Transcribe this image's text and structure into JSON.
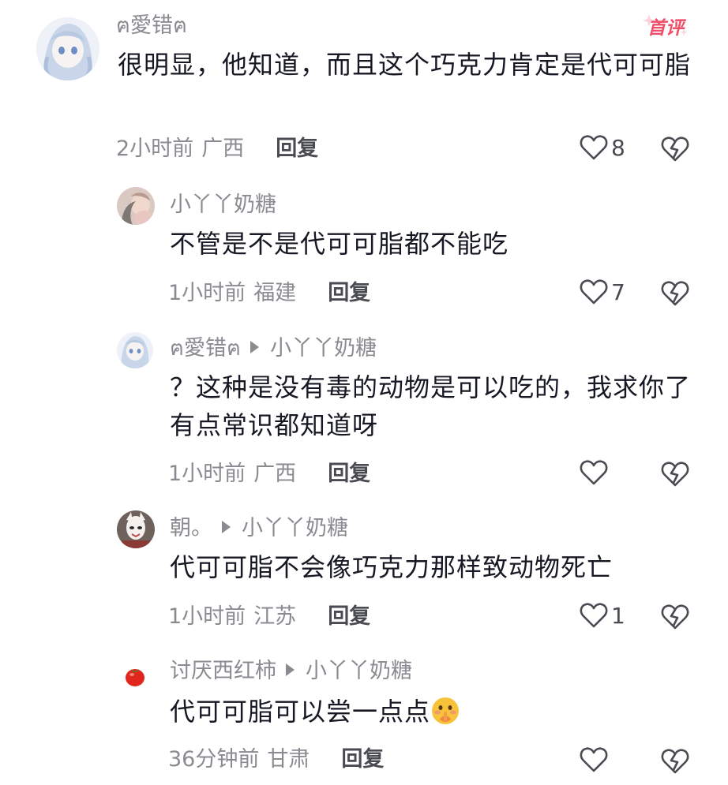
{
  "comments": [
    {
      "username": "ฅ愛错ฅ",
      "badge": "首评",
      "text": "很明显，他知道，而且这个巧克力肯定是代可可脂",
      "time": "2小时前",
      "location": "广西",
      "reply_label": "回复",
      "likes": "8",
      "avatar_icon": "anime-girl-avatar"
    },
    {
      "username": "小丫丫奶糖",
      "text": "不管是不是代可可脂都不能吃",
      "time": "1小时前",
      "location": "福建",
      "reply_label": "回复",
      "likes": "7",
      "avatar_icon": "person-photo-avatar"
    },
    {
      "username": "ฅ愛错ฅ",
      "reply_to": "小丫丫奶糖",
      "text": "？这种是没有毒的动物是可以吃的，我求你了有点常识都知道呀",
      "time": "1小时前",
      "location": "广西",
      "reply_label": "回复",
      "likes": "",
      "avatar_icon": "anime-girl-avatar"
    },
    {
      "username": "朝。",
      "reply_to": "小丫丫奶糖",
      "text": "代可可脂不会像巧克力那样致动物死亡",
      "time": "1小时前",
      "location": "江苏",
      "reply_label": "回复",
      "likes": "1",
      "avatar_icon": "masked-figure-avatar"
    },
    {
      "username": "讨厌西红柿",
      "reply_to": "小丫丫奶糖",
      "text": "代可可脂可以尝一点点",
      "emoji": "shushing-face-emoji",
      "time": "36分钟前",
      "location": "甘肃",
      "reply_label": "回复",
      "likes": "",
      "avatar_icon": "tomato-avatar"
    }
  ],
  "colors": {
    "text": "#161823",
    "meta": "#8a8b91",
    "reply": "#4a4b52",
    "badge": "#f04e68"
  }
}
